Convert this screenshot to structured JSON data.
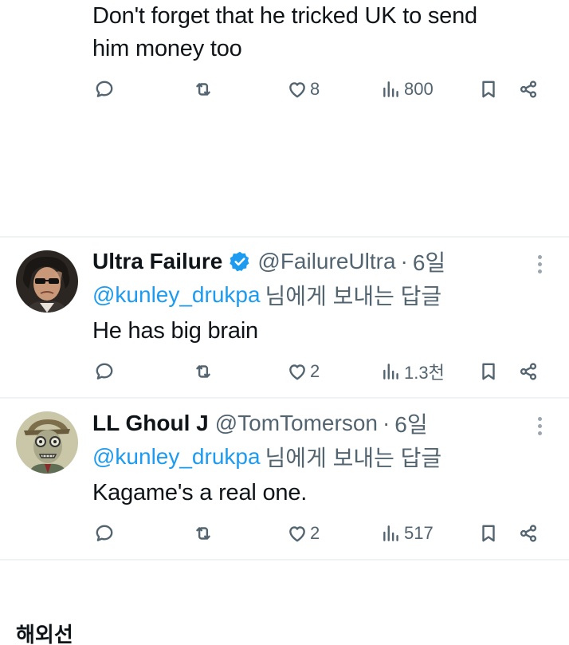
{
  "tweet_top": {
    "text_line1": "Don't forget that he tricked UK to send",
    "text_line2": "him money too",
    "likes": "8",
    "views": "800"
  },
  "reply1": {
    "display_name": "Ultra Failure",
    "handle": "@FailureUltra",
    "separator": "·",
    "time": "6일",
    "reply_to": "@kunley_drukpa",
    "reply_suffix": "님에게 보내는 답글",
    "text": "He has big brain",
    "likes": "2",
    "views": "1.3천",
    "verified": true
  },
  "reply2": {
    "display_name": "LL Ghoul J",
    "handle": "@TomTomerson",
    "separator": "·",
    "time": "6일",
    "reply_to": "@kunley_drukpa",
    "reply_suffix": "님에게 보내는 답글",
    "text": "Kagame's a real one.",
    "likes": "2",
    "views": "517"
  },
  "footer": {
    "text": "해외선"
  },
  "colors": {
    "text": "#0f1419",
    "secondary": "#536471",
    "accent": "#1d9bf0",
    "divider": "#eff3f4"
  },
  "icons": [
    "reply-icon",
    "retweet-icon",
    "heart-icon",
    "views-icon",
    "bookmark-icon",
    "share-icon",
    "verified-badge-icon",
    "more-icon"
  ]
}
